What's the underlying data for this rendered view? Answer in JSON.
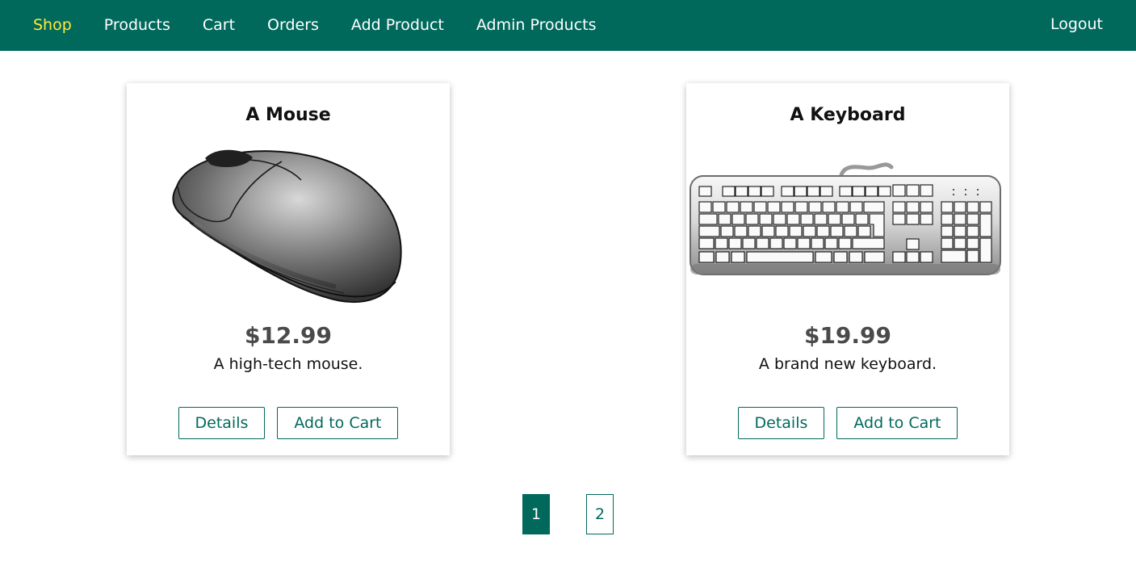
{
  "nav": {
    "items": [
      {
        "label": "Shop",
        "active": true
      },
      {
        "label": "Products",
        "active": false
      },
      {
        "label": "Cart",
        "active": false
      },
      {
        "label": "Orders",
        "active": false
      },
      {
        "label": "Add Product",
        "active": false
      },
      {
        "label": "Admin Products",
        "active": false
      }
    ],
    "logout": "Logout"
  },
  "products": [
    {
      "title": "A Mouse",
      "image": "mouse-image",
      "price": "$12.99",
      "description": "A high-tech mouse.",
      "details_label": "Details",
      "cart_label": "Add to Cart"
    },
    {
      "title": "A Keyboard",
      "image": "keyboard-image",
      "price": "$19.99",
      "description": "A brand new keyboard.",
      "details_label": "Details",
      "cart_label": "Add to Cart"
    }
  ],
  "pagination": {
    "pages": [
      "1",
      "2"
    ],
    "current": "1"
  },
  "colors": {
    "primary": "#00695c",
    "active_nav": "#ffeb3b"
  }
}
